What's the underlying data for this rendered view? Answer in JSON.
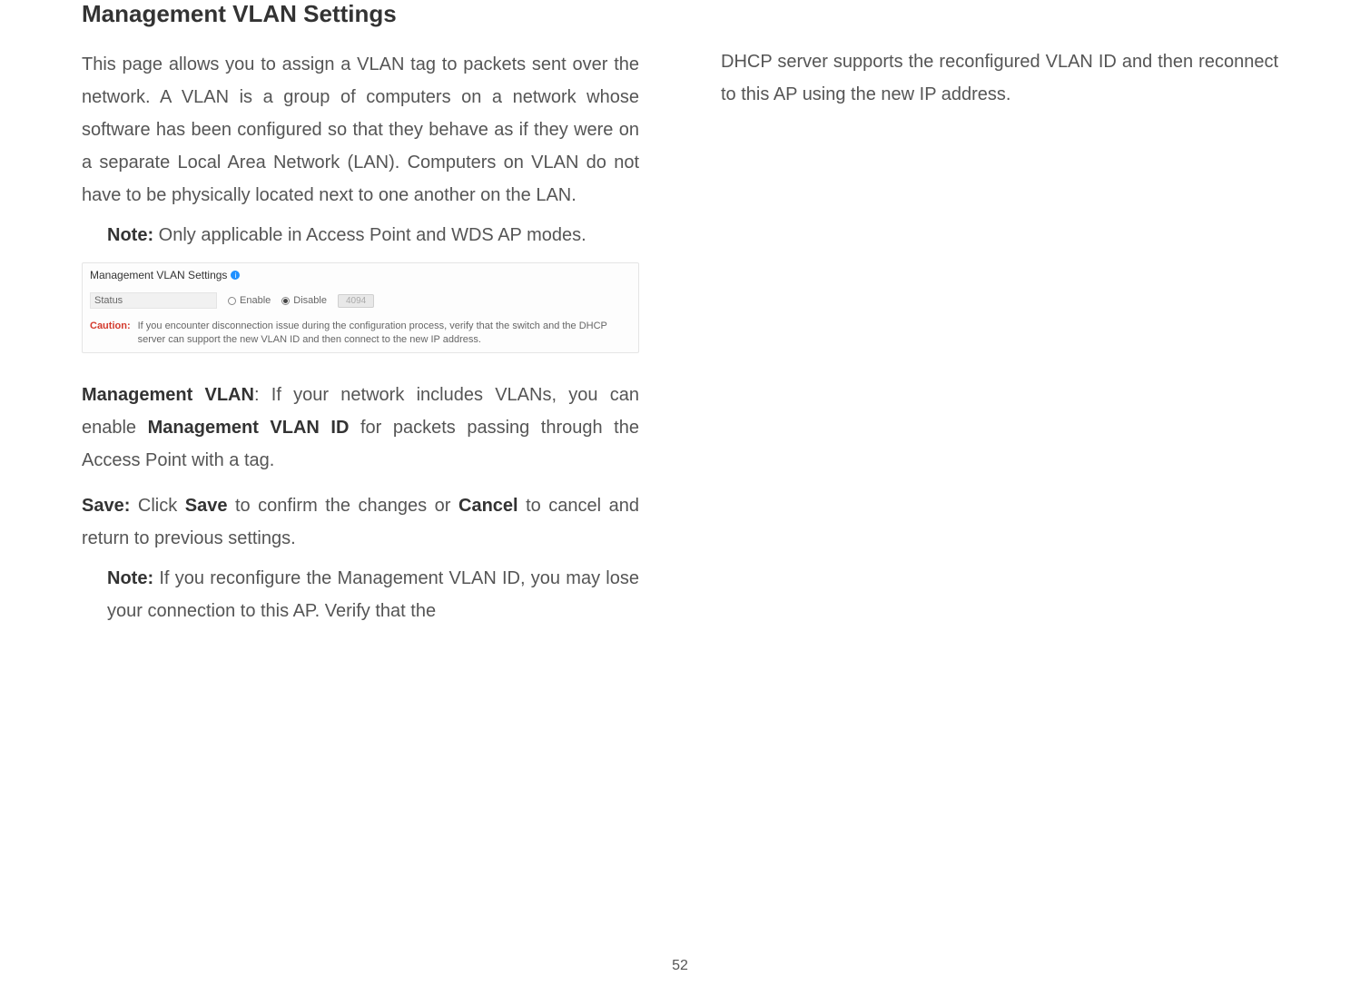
{
  "heading": "Management VLAN Settings",
  "para1": "This page allows you to assign a VLAN tag to packets sent over the network. A VLAN is a group of computers on a network whose software has been configured so that they behave as if they were on a separate Local Area Network (LAN). Computers on VLAN do not have to be physically located next to one another on the LAN.",
  "note1_label": "Note:",
  "note1_text": " Only applicable in Access Point and WDS AP modes.",
  "screenshot": {
    "title": "Management VLAN Settings",
    "status_label": "Status",
    "enable": "Enable",
    "disable": "Disable",
    "vlan_id": "4094",
    "caution_label": "Caution:",
    "caution_text": "If you encounter disconnection issue during the configuration process, verify that the switch and the DHCP server can support the new VLAN ID and then connect to the new IP address."
  },
  "mvlan_label": "Management VLAN",
  "mvlan_text": ": If your network includes VLANs, you can enable ",
  "mvlan_id_label": "Management VLAN ID",
  "mvlan_text2": " for packets passing through the Access Point with a tag.",
  "save_label": "Save:",
  "save_text": " Click ",
  "save_bold": "Save",
  "save_text2": " to confirm the changes or ",
  "cancel_bold": "Cancel",
  "save_text3": " to cancel and return to previous settings.",
  "note2_label": "Note:",
  "note2_text": " If you reconfigure the Management VLAN ID, you may lose your connection to this AP. Verify that the",
  "right_text": "DHCP server supports the reconfigured VLAN ID and then reconnect to this AP using the new IP address.",
  "page_number": "52"
}
